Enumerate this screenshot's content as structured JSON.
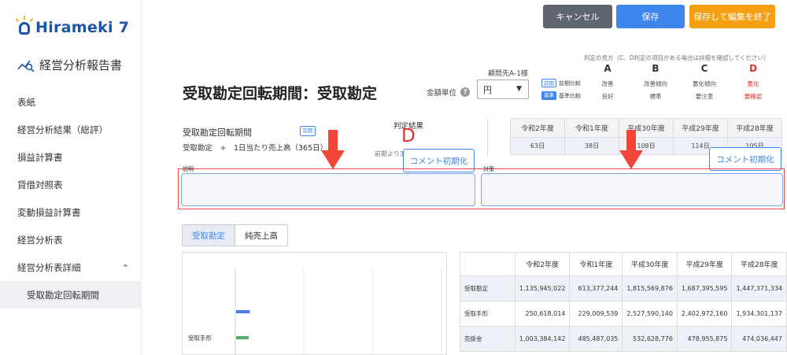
{
  "app": {
    "logo_text": "Hirameki 7",
    "report_title": "経営分析報告書"
  },
  "sidebar": {
    "items": [
      {
        "label": "表紙"
      },
      {
        "label": "経営分析結果（総評）"
      },
      {
        "label": "損益計算書"
      },
      {
        "label": "貸借対照表"
      },
      {
        "label": "変動損益計算書"
      },
      {
        "label": "経営分析表"
      },
      {
        "label": "経営分析表詳細"
      },
      {
        "label": "受取勘定回転期間"
      }
    ]
  },
  "toolbar": {
    "cancel_label": "キャンセル",
    "save_label": "保存",
    "save_exit_label": "保存して編集を終了"
  },
  "header": {
    "page_title": "受取勘定回転期間：受取勘定",
    "client_name": "顧問先A-1様",
    "unit_label": "金額単位",
    "unit_value": "円"
  },
  "legend": {
    "heading": "判定の見方（C、D判定の項目がある場合は詳細を確認してください）",
    "grades": [
      "A",
      "B",
      "C",
      "D"
    ],
    "prev_tag": "前期",
    "prev_label": "前期比較",
    "base_tag": "基準",
    "base_label": "基準比較",
    "prev_desc": [
      "改善",
      "改善傾向",
      "悪化傾向",
      "悪化"
    ],
    "base_desc": [
      "良好",
      "標準",
      "要注意",
      "要確認"
    ],
    "colors": {
      "grade_d": "#e0302e",
      "accent": "#3f86ec"
    }
  },
  "metric": {
    "name": "受取勘定回転期間",
    "tag": "前期",
    "formula": "受取勘定　÷　1日当たり売上高（365日）",
    "judge_title": "判定結果",
    "judge_value": "D",
    "judge_note": "前期より3"
  },
  "years": {
    "headers": [
      "令和2年度",
      "令和1年度",
      "平成30年度",
      "平成29年度",
      "平成28年度"
    ],
    "values": [
      "63日",
      "38日",
      "108日",
      "114日",
      "105日"
    ]
  },
  "comment": {
    "reset_label": "コメント初期化",
    "desc_label": "説明",
    "measure_label": "対策"
  },
  "tabs": [
    {
      "label": "受取勘定"
    },
    {
      "label": "純売上高"
    }
  ],
  "chart_data": {
    "type": "bar",
    "categories": [
      "受取手形"
    ],
    "series": [
      {
        "values": [
          250618014
        ]
      },
      {
        "values": [
          229009539
        ]
      }
    ],
    "colors": [
      "#4a7fe0",
      "#4fb06a"
    ]
  },
  "table": {
    "headers": [
      "令和2年度",
      "令和1年度",
      "平成30年度",
      "平成29年度",
      "平成28年度"
    ],
    "rows": [
      {
        "label": "受取勘定",
        "values": [
          "1,135,945,022",
          "613,377,244",
          "1,815,569,876",
          "1,687,395,595",
          "1,447,371,334"
        ]
      },
      {
        "label": "受取手形",
        "values": [
          "250,618,014",
          "229,009,539",
          "2,527,590,140",
          "2,402,972,160",
          "1,934,301,137"
        ]
      },
      {
        "label": "売掛金",
        "values": [
          "1,003,384,142",
          "485,487,035",
          "532,628,776",
          "478,955,875",
          "474,036,447"
        ]
      }
    ]
  }
}
